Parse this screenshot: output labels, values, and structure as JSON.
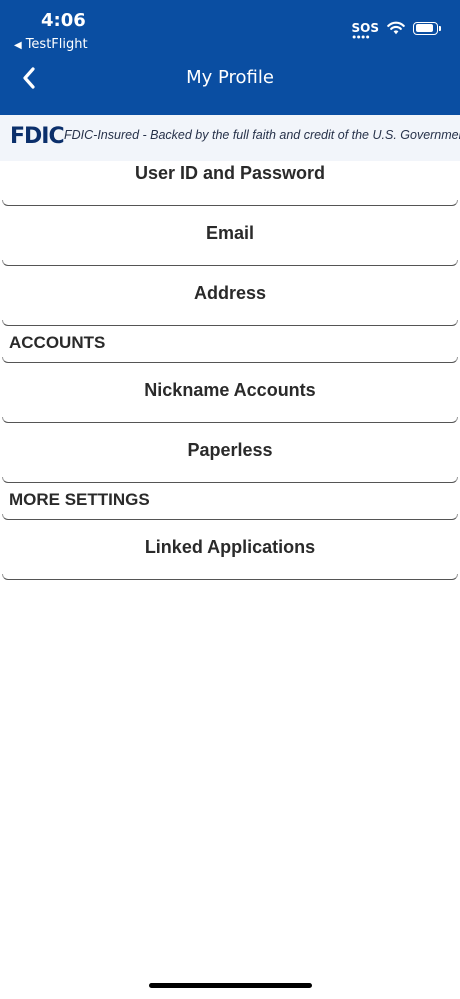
{
  "status_bar": {
    "time": "4:06",
    "back_app": "TestFlight",
    "sos": "SOS"
  },
  "nav": {
    "title": "My Profile",
    "back_icon": "chevron-left-icon"
  },
  "fdic_banner": {
    "logo": "FDIC",
    "text": "FDIC-Insured - Backed by the full faith and credit of the U.S. Government"
  },
  "profile_items": [
    {
      "label": "User ID and Password"
    },
    {
      "label": "Email"
    },
    {
      "label": "Address"
    }
  ],
  "accounts_section": {
    "header": "ACCOUNTS",
    "items": [
      {
        "label": "Nickname Accounts"
      },
      {
        "label": "Paperless"
      }
    ]
  },
  "more_settings_section": {
    "header": "MORE SETTINGS",
    "items": [
      {
        "label": "Linked Applications"
      }
    ]
  },
  "colors": {
    "header_bg": "#0a4ea2",
    "banner_bg": "#f2f5fa",
    "fdic_logo": "#0b2f6b",
    "text": "#2a2a2a"
  }
}
